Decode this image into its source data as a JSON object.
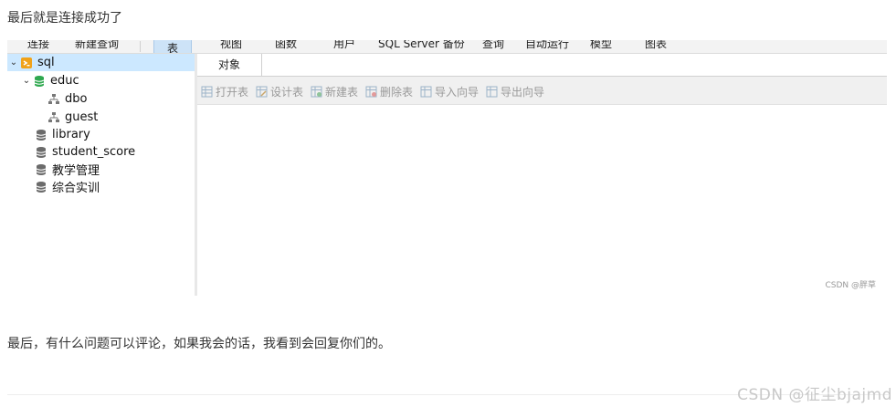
{
  "intro_text": "最后就是连接成功了",
  "toolbar": {
    "items": [
      "连接",
      "新建查询",
      "表",
      "视图",
      "函数",
      "用户",
      "SQL Server 备份",
      "查询",
      "自动运行",
      "模型",
      "图表"
    ],
    "active": "表"
  },
  "tree": {
    "root": "sql",
    "db_open": "educ",
    "schemas": [
      "dbo",
      "guest"
    ],
    "databases": [
      "library",
      "student_score",
      "教学管理",
      "综合实训"
    ]
  },
  "tab": {
    "label": "对象"
  },
  "object_tools": [
    "打开表",
    "设计表",
    "新建表",
    "删除表",
    "导入向导",
    "导出向导"
  ],
  "inner_watermark": "CSDN @胖草",
  "closing_text": "最后，有什么问题可以评论，如果我会的话，我看到会回复你们的。",
  "footer_watermark": "CSDN @征尘bjajmd",
  "colors": {
    "selection": "#cce8ff",
    "db_open_icon": "#2fa84f",
    "db_icon": "#6b6b6b",
    "connection_icon": "#f0a21a"
  }
}
